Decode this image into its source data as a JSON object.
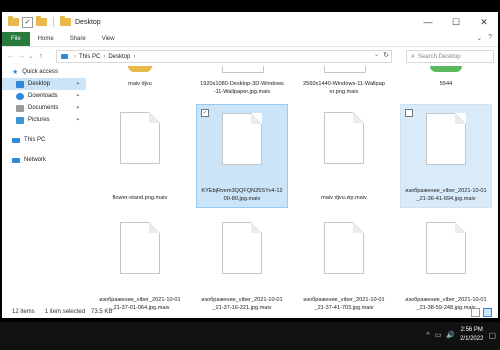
{
  "window": {
    "title": "Desktop",
    "controls": {
      "minimize": "—",
      "maximize": "☐",
      "close": "✕"
    }
  },
  "ribbon": {
    "tabs": [
      "File",
      "Home",
      "Share",
      "View"
    ],
    "help_glyph": "?"
  },
  "address": {
    "back": "←",
    "forward": "→",
    "up": "↑",
    "path": [
      "This PC",
      "Desktop"
    ],
    "refresh": "↻",
    "search_placeholder": "Search Desktop"
  },
  "sidebar": {
    "items": [
      {
        "label": "Quick access",
        "icon": "star-icon",
        "color": "#2e8ad8"
      },
      {
        "label": "Desktop",
        "icon": "desktop-icon",
        "color": "#2e8ad8",
        "selected": true,
        "pinned": true
      },
      {
        "label": "Downloads",
        "icon": "download-icon",
        "color": "#2e8ad8",
        "pinned": true
      },
      {
        "label": "Documents",
        "icon": "documents-icon",
        "color": "#8a8a8a",
        "pinned": true
      },
      {
        "label": "Pictures",
        "icon": "pictures-icon",
        "color": "#2e8ad8",
        "pinned": true
      },
      {
        "label": "This PC",
        "icon": "pc-icon",
        "color": "#2e8ad8"
      },
      {
        "label": "Network",
        "icon": "network-icon",
        "color": "#2e8ad8"
      }
    ],
    "pin_glyph": "📌"
  },
  "files_top": [
    {
      "name": "maiv djvu"
    },
    {
      "name": "1920x1080-Desktop-3D-Windows-11-Wallpaper.jpg.maiv"
    },
    {
      "name": "2560x1440-Windows-11-Wallpaper.png.maiv"
    },
    {
      "name": "5544"
    }
  ],
  "files": [
    {
      "name": "flower-stand.png.maiv",
      "selected": false
    },
    {
      "name": "KYEbjRvem3QQFQN25SYv4-1200-80.jpg.maiv",
      "selected": true
    },
    {
      "name": "maiv djvu.zip.maiv",
      "selected": false
    },
    {
      "name": "изображение_viber_2021-10-01_21-36-41-694.jpg.maiv",
      "selected": false
    },
    {
      "name": "изображение_viber_2021-10-01_21-37-01-064.jpg.maiv",
      "selected": false
    },
    {
      "name": "изображение_viber_2021-10-01_21-37-16-221.jpg.maiv",
      "selected": false
    },
    {
      "name": "изображение_viber_2021-10-01_21-37-41-703.jpg.maiv",
      "selected": false
    },
    {
      "name": "изображение_viber_2021-10-01_21-38-59-248.jpg.maiv",
      "selected": false
    }
  ],
  "status": {
    "items_count": "12 items",
    "selected": "1 item selected",
    "size": "73.5 KB"
  },
  "taskbar": {
    "time": "2:56 PM",
    "date": "2/1/2022",
    "tray_icons": [
      "^",
      "▭",
      "🔊"
    ]
  },
  "colors": {
    "accent": "#2e8ad8",
    "selection": "#cce4f7",
    "file_tab": "#2a7a3e"
  }
}
